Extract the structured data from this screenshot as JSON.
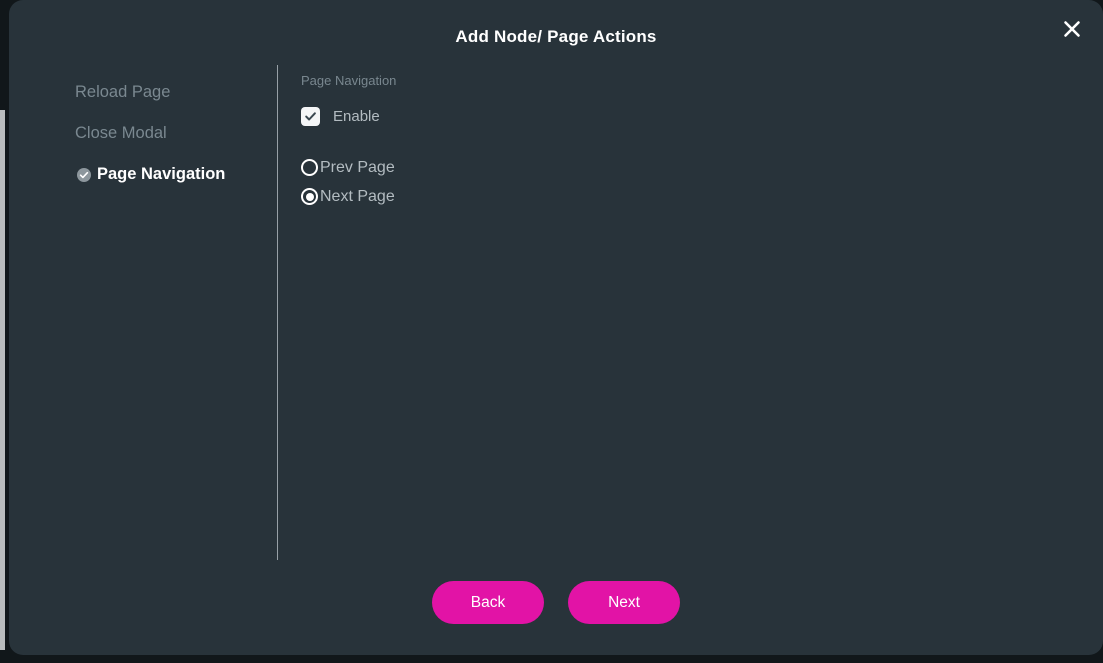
{
  "modal": {
    "title": "Add Node/ Page Actions",
    "close_icon": "close-icon",
    "background_color": "#28333a",
    "accent_color": "#e213a6"
  },
  "steps": [
    {
      "label": "Reload Page",
      "active": false,
      "completed": false
    },
    {
      "label": "Close Modal",
      "active": false,
      "completed": false
    },
    {
      "label": "Page Navigation",
      "active": true,
      "completed": true,
      "icon": "check-circle-icon"
    }
  ],
  "form": {
    "section_label": "Page Navigation",
    "checkbox": {
      "label": "Enable",
      "checked": true,
      "icon": "checkmark-icon"
    },
    "radio_group": {
      "name": "page-navigation-direction",
      "selected": "Next Page",
      "options": [
        {
          "label": "Prev Page",
          "selected": false
        },
        {
          "label": "Next Page",
          "selected": true
        }
      ]
    }
  },
  "footer": {
    "back_label": "Back",
    "next_label": "Next"
  }
}
